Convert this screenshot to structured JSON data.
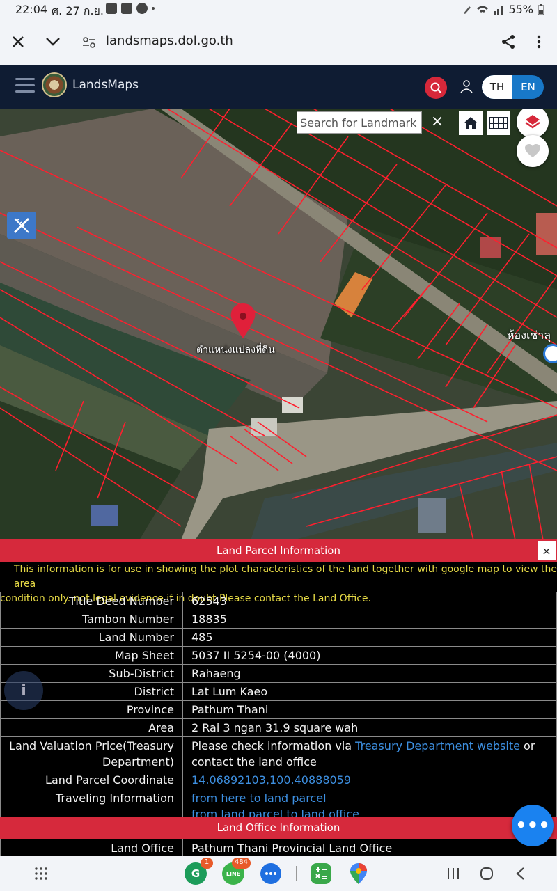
{
  "status_bar": {
    "time": "22:04",
    "date": "ศ. 27 ก.ย.",
    "battery": "55%"
  },
  "browser": {
    "url": "landsmaps.dol.go.th"
  },
  "header": {
    "brand": "LandsMaps",
    "lang_th": "TH",
    "lang_en": "EN"
  },
  "map": {
    "search_placeholder": "Search for Landmark",
    "close_symbol": "×",
    "pin_label": "ตำแหน่งแปลงที่ดิน",
    "edge_label": "ห้องเช่าลุ"
  },
  "panel": {
    "title": "Land Parcel Information",
    "close_symbol": "×",
    "disclaimer_1": "This information is for use in showing the plot characteristics of the land together with google map to view the area",
    "disclaimer_2": "condition only. not legal evidence if in doubt Please contact the Land Office.",
    "rows": [
      {
        "key": "Title Deed Number",
        "value": "62543"
      },
      {
        "key": "Tambon Number",
        "value": "18835"
      },
      {
        "key": "Land Number",
        "value": "485"
      },
      {
        "key": "Map Sheet",
        "value": "5037 II 5254-00 (4000)"
      },
      {
        "key": "Sub-District",
        "value": "Rahaeng"
      },
      {
        "key": "District",
        "value": "Lat Lum Kaeo"
      },
      {
        "key": "Province",
        "value": "Pathum Thani"
      },
      {
        "key": "Area",
        "value": "2 Rai 3 ngan 31.9 square wah"
      }
    ],
    "valuation": {
      "key": "Land Valuation Price(Treasury Department)",
      "prefix": "Please check information via ",
      "link": "Treasury Department website",
      "suffix": " or contact the land office"
    },
    "coordinate": {
      "key": "Land Parcel Coordinate",
      "value": "14.06892103,100.40888059"
    },
    "travel": {
      "key": "Traveling Information",
      "link_1": "from here to land parcel",
      "link_2": "from land parcel to land office"
    },
    "office_section_title": "Land Office Information",
    "office": {
      "key": "Land Office",
      "value": "Pathum Thani Provincial Land Office"
    }
  },
  "fab": {
    "chat_symbol": "•••",
    "info_symbol": "i"
  },
  "nav": {
    "badge_1": "1",
    "badge_2": "484",
    "line_label": "LINE"
  },
  "colors": {
    "header_bg": "#0f1c33",
    "accent_red": "#d6293c",
    "link_blue": "#3d8fe0",
    "lang_blue": "#1878c8",
    "parcel_red": "#ff1f2e"
  }
}
